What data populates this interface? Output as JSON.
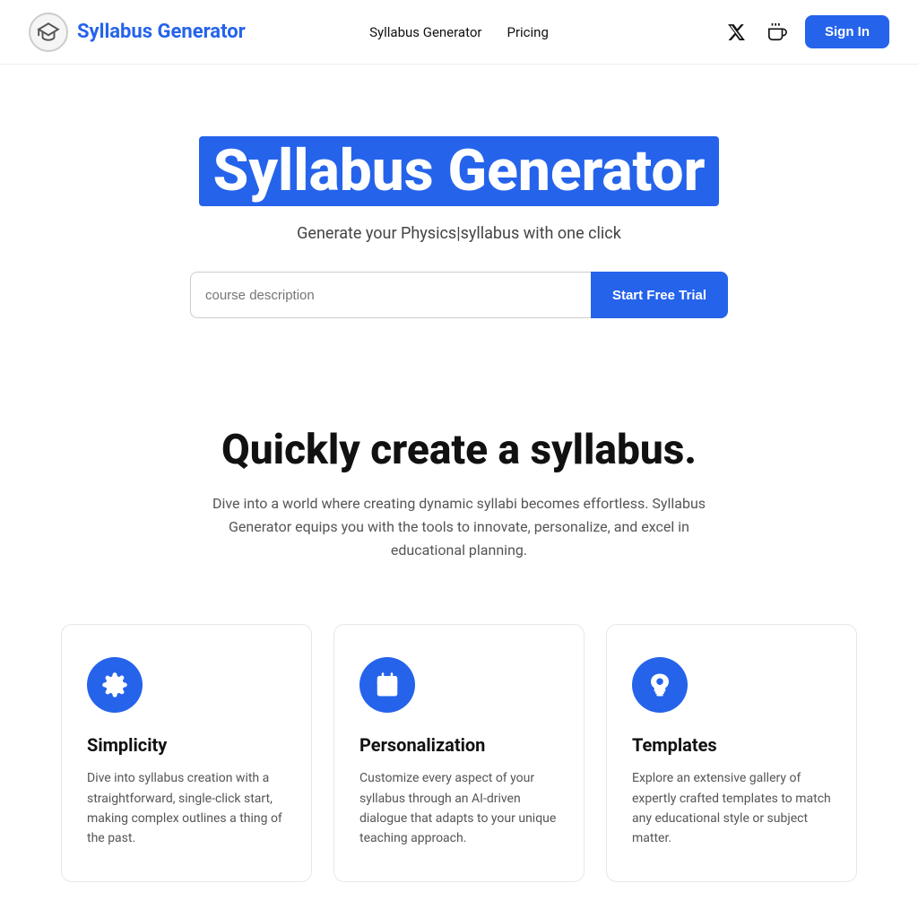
{
  "nav": {
    "brand": "Syllabus Generator",
    "links": [
      {
        "label": "Syllabus Generator",
        "id": "nav-link-syllabus"
      },
      {
        "label": "Pricing",
        "id": "nav-link-pricing"
      }
    ],
    "signin_label": "Sign In",
    "twitter_icon": "𝕏",
    "coffee_icon": "☕"
  },
  "hero": {
    "title": "Syllabus Generator",
    "subtitle": "Generate your Physics|syllabus with one click",
    "input_placeholder": "course description",
    "cta_label": "Start Free Trial"
  },
  "features": {
    "heading": "Quickly create a syllabus.",
    "subtext": "Dive into a world where creating dynamic syllabi becomes effortless. Syllabus Generator equips you with the tools to innovate, personalize, and excel in educational planning."
  },
  "cards": [
    {
      "id": "card-simplicity",
      "icon": "gear",
      "title": "Simplicity",
      "description": "Dive into syllabus creation with a straightforward, single-click start, making complex outlines a thing of the past."
    },
    {
      "id": "card-personalization",
      "icon": "calendar",
      "title": "Personalization",
      "description": "Customize every aspect of your syllabus through an AI-driven dialogue that adapts to your unique teaching approach."
    },
    {
      "id": "card-templates",
      "icon": "star",
      "title": "Templates",
      "description": "Explore an extensive gallery of expertly crafted templates to match any educational style or subject matter."
    }
  ]
}
